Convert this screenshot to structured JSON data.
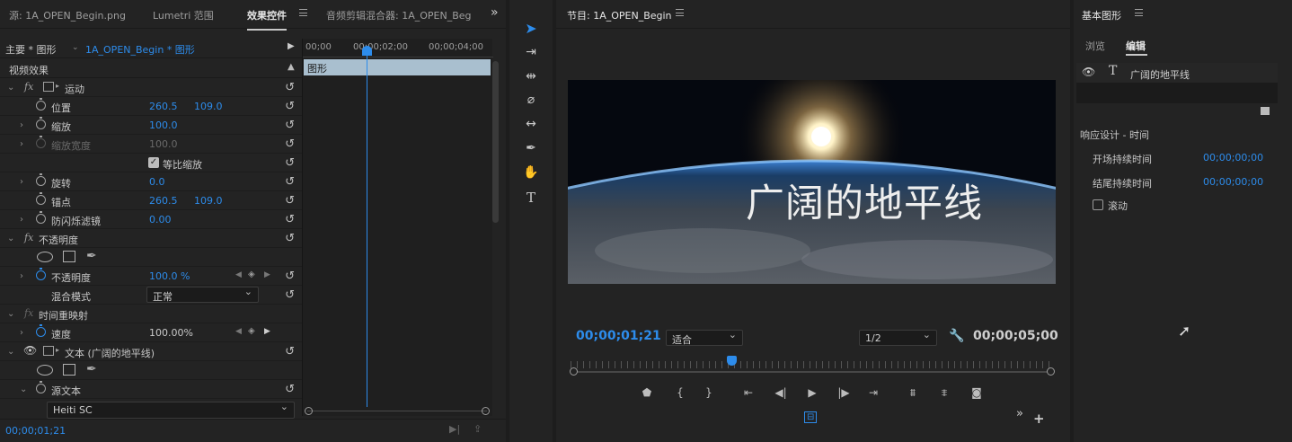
{
  "left_tabs": {
    "source": "源: 1A_OPEN_Begin.png",
    "lumetri": "Lumetri 范围",
    "effects": "效果控件",
    "audio_mixer": "音频剪辑混合器: 1A_OPEN_Beg",
    "more": "»"
  },
  "effects_panel": {
    "master": "主要 * 图形",
    "clip": "1A_OPEN_Begin * 图形",
    "ruler": [
      "00;00",
      "00;00;02;00",
      "00;00;04;00"
    ],
    "clip_bar": "图形",
    "section": "视频效果",
    "rows": [
      {
        "label": "运动",
        "fx": "fx"
      },
      {
        "label": "位置",
        "v1": "260.5",
        "v2": "109.0"
      },
      {
        "label": "缩放",
        "v1": "100.0"
      },
      {
        "label": "缩放宽度",
        "v1": "100.0"
      },
      {
        "label": "等比缩放"
      },
      {
        "label": "旋转",
        "v1": "0.0"
      },
      {
        "label": "锚点",
        "v1": "260.5",
        "v2": "109.0"
      },
      {
        "label": "防闪烁滤镜",
        "v1": "0.00"
      },
      {
        "label": "不透明度",
        "fx": "fx"
      },
      {
        "label": ""
      },
      {
        "label": "不透明度",
        "v1": "100.0 %"
      },
      {
        "label": "混合模式",
        "v1": "正常"
      },
      {
        "label": "时间重映射",
        "fx": "fx"
      },
      {
        "label": "速度",
        "v1": "100.00%"
      },
      {
        "label": "文本 (广阔的地平线)"
      },
      {
        "label": ""
      },
      {
        "label": "源文本"
      }
    ],
    "font": "Heiti SC",
    "timecode": "00;00;01;21"
  },
  "program": {
    "title": "节目: 1A_OPEN_Begin",
    "overlay_text": "广阔的地平线",
    "timecode": "00;00;01;21",
    "fit": "适合",
    "resolution": "1/2",
    "duration": "00;00;05;00",
    "playhead_fraction": 0.33
  },
  "essential_graphics": {
    "title": "基本图形",
    "tab_browse": "浏览",
    "tab_edit": "编辑",
    "layer": "广阔的地平线",
    "responsive": "响应设计 - 时间",
    "intro_label": "开场持续时间",
    "intro_value": "00;00;00;00",
    "outro_label": "结尾持续时间",
    "outro_value": "00;00;00;00",
    "roll": "滚动"
  },
  "colors": {
    "accent": "#2d8ceb",
    "panel": "#232323"
  }
}
